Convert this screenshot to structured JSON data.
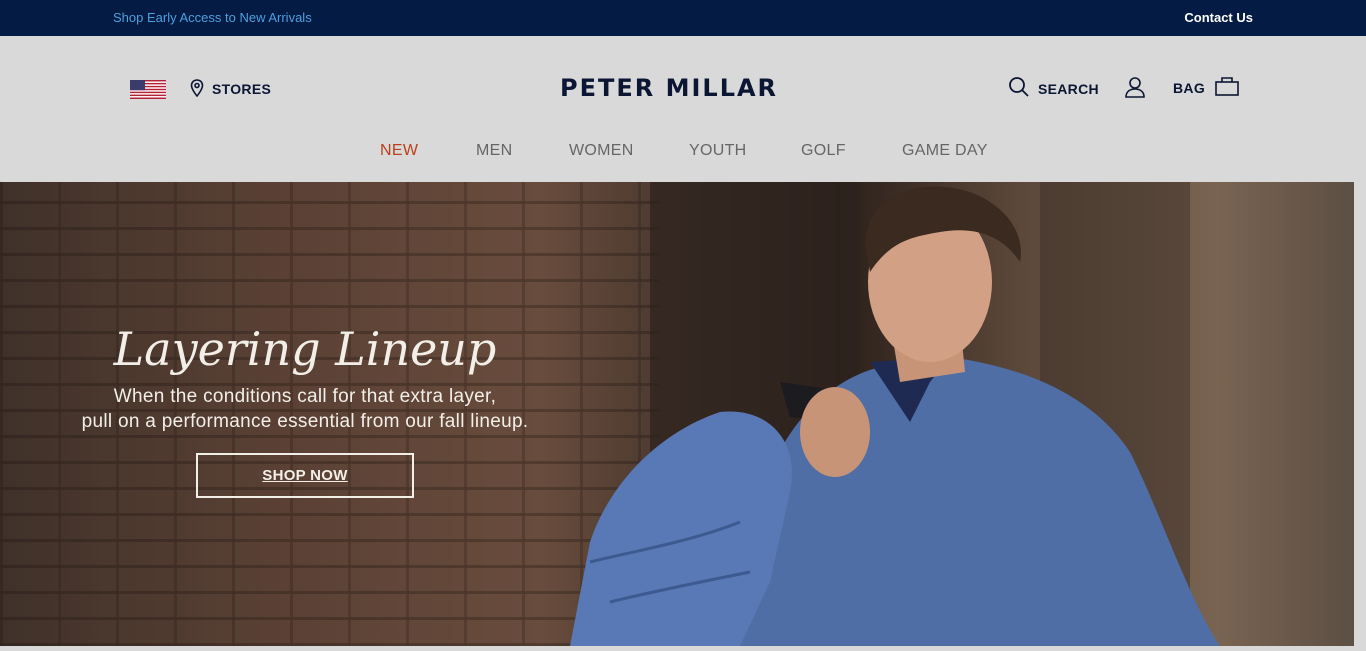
{
  "topbar": {
    "promo_link": "Shop Early Access to New Arrivals",
    "contact_link": "Contact Us"
  },
  "header": {
    "stores_label": "STORES",
    "logo_text": "PETER MILLAR",
    "search_label": "SEARCH",
    "bag_label": "BAG"
  },
  "nav": {
    "items": [
      {
        "label": "NEW",
        "active": true
      },
      {
        "label": "MEN"
      },
      {
        "label": "WOMEN"
      },
      {
        "label": "YOUTH"
      },
      {
        "label": "GOLF"
      },
      {
        "label": "GAME DAY"
      }
    ]
  },
  "hero": {
    "title": "Layering Lineup",
    "subtitle_line1": "When the conditions call for that extra layer,",
    "subtitle_line2": "pull on a performance essential from our fall lineup.",
    "cta_label": "SHOP NOW"
  },
  "colors": {
    "topbar_bg": "#041c44",
    "promo_link": "#4d9fe0",
    "nav_active": "#b8401a",
    "brand_navy": "#0a1633"
  },
  "icons": [
    "us-flag-icon",
    "location-pin-icon",
    "search-icon",
    "account-icon",
    "bag-icon"
  ]
}
